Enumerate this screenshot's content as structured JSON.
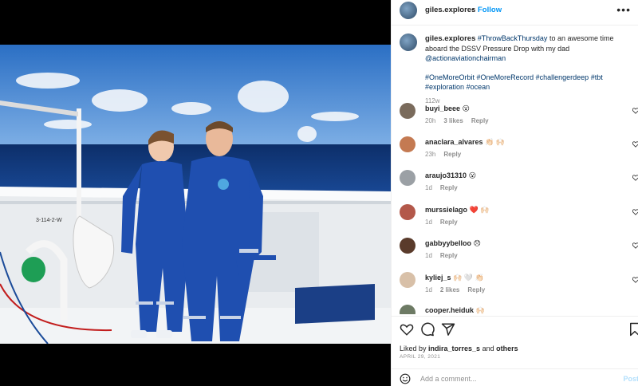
{
  "post": {
    "username": "giles.explores",
    "follow_label": "Follow",
    "caption": {
      "author": "giles.explores",
      "hashtag1": "#ThrowBackThursday",
      "text1": " to an awesome time aboard the DSSV Pressure Drop with my dad ",
      "mention": "@actionaviationchairman",
      "tags": [
        "#OneMoreOrbit",
        "#OneMoreRecord",
        "#challengerdeep",
        "#tbt",
        "#exploration",
        "#ocean"
      ],
      "age": "112w"
    },
    "comments": [
      {
        "user": "buyi_beee",
        "text": "😮",
        "age": "20h",
        "likes": "3 likes",
        "reply": "Reply"
      },
      {
        "user": "anaclara_alvares",
        "text": "👏🏻 🙌🏻",
        "age": "23h",
        "likes": "",
        "reply": "Reply"
      },
      {
        "user": "araujo31310",
        "text": "😮",
        "age": "1d",
        "likes": "",
        "reply": "Reply"
      },
      {
        "user": "murssielago",
        "text": "❤️ 🙌🏻",
        "age": "1d",
        "likes": "",
        "reply": "Reply"
      },
      {
        "user": "gabbyybelloo",
        "text": "😞",
        "age": "1d",
        "likes": "",
        "reply": "Reply"
      },
      {
        "user": "kyliej_s",
        "text": "🙌🏻 🤍 👏🏻",
        "age": "1d",
        "likes": "2 likes",
        "reply": "Reply"
      },
      {
        "user": "cooper.heiduk",
        "text": "🙌🏻",
        "age": "",
        "likes": "",
        "reply": ""
      }
    ],
    "liked_by_prefix": "Liked by ",
    "liked_by_user": "indira_torres_s",
    "liked_by_mid": " and ",
    "liked_by_others": "others",
    "date": "APRIL 29, 2021",
    "add_comment_placeholder": "Add a comment...",
    "post_label": "Post"
  },
  "colors": {
    "accent": "#0095f6",
    "link": "#00376b",
    "muted": "#8e8e8e",
    "suit": "#1f4fb0"
  },
  "icons": [
    "more-options-icon",
    "heart-icon",
    "comment-icon",
    "share-icon",
    "bookmark-icon",
    "emoji-icon"
  ]
}
